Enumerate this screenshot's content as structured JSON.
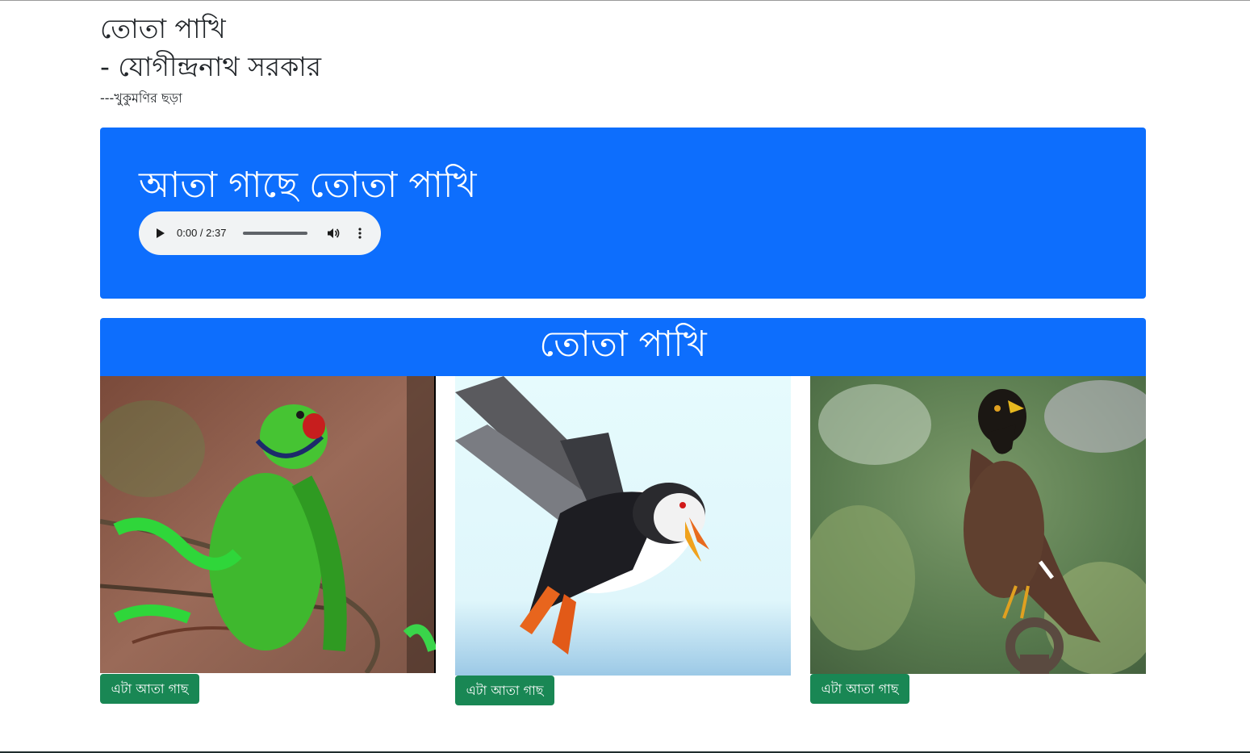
{
  "header": {
    "title": "তোতা পাখি",
    "author": "- যোগীন্দ্রনাথ সরকার",
    "book": "---খুকুমণির ছড়া"
  },
  "hero": {
    "title": "আতা গাছে তোতা পাখি",
    "audio": {
      "time": "0:00 / 2:37",
      "progress": 0
    }
  },
  "gallery": {
    "title": "তোতা পাখি",
    "cards": [
      {
        "image": "parrot-photo",
        "button_label": "এটা আতা গাছ"
      },
      {
        "image": "puffin-photo",
        "button_label": "এটা আতা গাছ"
      },
      {
        "image": "myna-photo",
        "button_label": "এটা আতা গাছ"
      }
    ]
  },
  "colors": {
    "primary": "#0d6efd",
    "success": "#198754",
    "audio_bg": "#f1f3f4"
  }
}
